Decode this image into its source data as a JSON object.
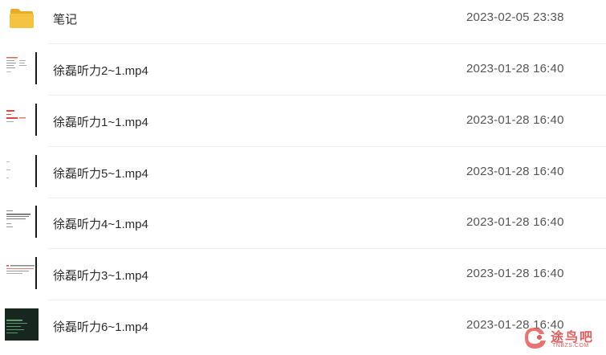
{
  "files": [
    {
      "name": "笔记",
      "date": "2023-02-05 23:38",
      "type": "folder-icon"
    },
    {
      "name": "徐磊听力2~1.mp4",
      "date": "2023-01-28 16:40",
      "type": "video-thumbnail"
    },
    {
      "name": "徐磊听力1~1.mp4",
      "date": "2023-01-28 16:40",
      "type": "video-thumbnail"
    },
    {
      "name": "徐磊听力5~1.mp4",
      "date": "2023-01-28 16:40",
      "type": "video-thumbnail"
    },
    {
      "name": "徐磊听力4~1.mp4",
      "date": "2023-01-28 16:40",
      "type": "video-thumbnail"
    },
    {
      "name": "徐磊听力3~1.mp4",
      "date": "2023-01-28 16:40",
      "type": "video-thumbnail"
    },
    {
      "name": "徐磊听力6~1.mp4",
      "date": "2023-01-28 16:40",
      "type": "video-thumbnail"
    }
  ],
  "watermark": {
    "text": "途鸟吧",
    "sub": "TNBZS.COM"
  },
  "colors": {
    "folder": "#f5c342",
    "thumb_red": "#e0443a",
    "thumb_dark": "#17261f",
    "watermark": "#e45b5b"
  }
}
